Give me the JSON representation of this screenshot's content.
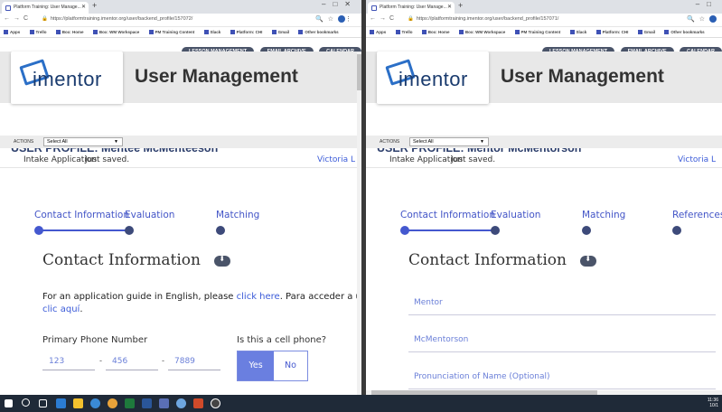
{
  "left": {
    "browser": {
      "tab_title": "Platform Training: User Manage...",
      "url": "https://platformtraining.imentor.org/user/backend_profile/157072/"
    },
    "profile_title": "USER PROFILE: Mentee McMenteeson",
    "steps": [
      "Contact Information",
      "Evaluation",
      "Matching"
    ],
    "guide_prefix": "For an application guide in English, please ",
    "guide_link": "click here",
    "guide_mid": ". Para acceder a una",
    "guide_link2": "clic aquí",
    "guide_end": ".",
    "phone_label": "Primary Phone Number",
    "phone": [
      "123",
      "456",
      "7889"
    ],
    "cell_label": "Is this a cell phone?",
    "yes": "Yes",
    "no": "No"
  },
  "right": {
    "browser": {
      "tab_title": "Platform Training: User Manage...",
      "url": "https://platformtraining.imentor.org/user/backend_profile/157071/"
    },
    "profile_title": "USER PROFILE: Mentor McMentorson",
    "steps": [
      "Contact Information",
      "Evaluation",
      "Matching",
      "References"
    ],
    "fields": [
      "Mentor",
      "McMentorson",
      "Pronunciation of Name (Optional)"
    ]
  },
  "shared": {
    "bookmarks": [
      "Apps",
      "Trello",
      "Box: Home",
      "Box: WM Workspace",
      "PM Training Content",
      "Slack",
      "Platform: CHI",
      "Gmail",
      "Other bookmarks"
    ],
    "nav": [
      "LESSON MANAGEMENT",
      "EMAIL ARCHIVE",
      "CALENDAR"
    ],
    "logo": "imentor",
    "banner_title": "User Management",
    "actions_label": "ACTIONS",
    "actions_select": "Select All",
    "intake_label": "Intake Application",
    "saved": "Just saved.",
    "user_link": "Victoria L",
    "section_title": "Contact Information",
    "clock_time": "11:36",
    "clock_date": "10/1"
  },
  "colors": {
    "accent": "#4458cf",
    "nav": "#4a5469",
    "taskbar": "#1f2a38"
  }
}
